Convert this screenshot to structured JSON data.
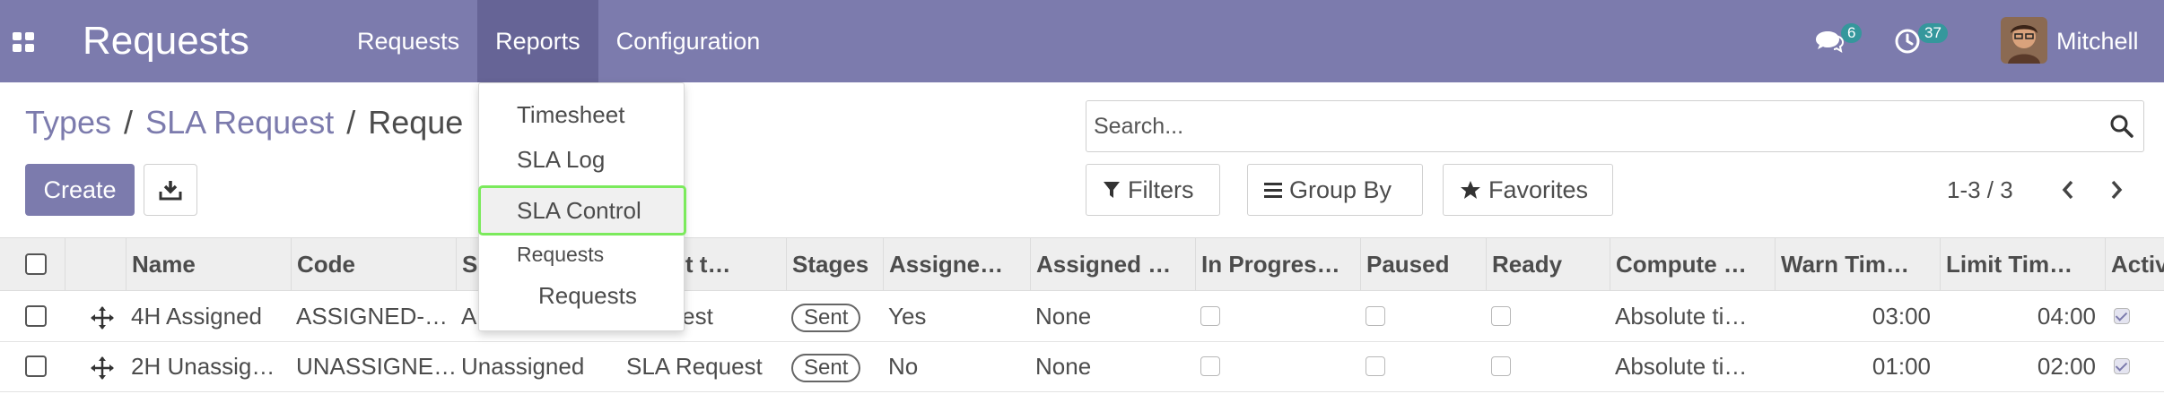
{
  "app": {
    "title": "Requests"
  },
  "menu": {
    "items": [
      "Requests",
      "Reports",
      "Configuration"
    ]
  },
  "systray": {
    "messages_count": "6",
    "activities_count": "37",
    "user_name": "Mitchell"
  },
  "reports_dropdown": {
    "items": [
      "Timesheet",
      "SLA Log",
      "SLA Control"
    ],
    "section_header": "Requests",
    "sub_items": [
      "Requests"
    ],
    "focused": "SLA Control"
  },
  "breadcrumb": {
    "items": [
      "Types",
      "SLA Request",
      "Reque"
    ]
  },
  "buttons": {
    "create": "Create"
  },
  "search": {
    "placeholder": "Search...",
    "value": ""
  },
  "filters": {
    "filters": "Filters",
    "group_by": "Group By",
    "favorites": "Favorites"
  },
  "pager": {
    "value": "1-3 / 3"
  },
  "table": {
    "columns": [
      "Name",
      "Code",
      "S",
      "est t…",
      "Stages",
      "Assigne…",
      "Assigned …",
      "In Progres…",
      "Paused",
      "Ready",
      "Compute …",
      "Warn Tim…",
      "Limit Tim…",
      "Activ"
    ],
    "rows": [
      {
        "name": "4H Assigned",
        "code": "ASSIGNED-…",
        "s": "A",
        "request_type": "Request",
        "stage": "Sent",
        "assigned": "Yes",
        "assigned_to": "None",
        "in_progress": false,
        "paused": false,
        "ready": false,
        "compute": "Absolute ti…",
        "warn_time": "03:00",
        "limit_time": "04:00",
        "active": true
      },
      {
        "name": "2H Unassig…",
        "code": "UNASSIGNE…",
        "s": "Unassigned",
        "request_type": "SLA Request",
        "stage": "Sent",
        "assigned": "No",
        "assigned_to": "None",
        "in_progress": false,
        "paused": false,
        "ready": false,
        "compute": "Absolute ti…",
        "warn_time": "01:00",
        "limit_time": "02:00",
        "active": true
      }
    ]
  },
  "colors": {
    "brand": "#7c7bad",
    "brand_active": "#666496",
    "badge": "#35979c",
    "focus_outline": "#7bea5c"
  },
  "icons": {
    "apps": "apps-grid-icon",
    "messages": "chat-bubble-icon",
    "activities": "clock-icon",
    "download": "download-icon",
    "search": "search-icon",
    "filter": "funnel-icon",
    "group_by": "bars-icon",
    "favorites": "star-icon",
    "prev": "chevron-left-icon",
    "next": "chevron-right-icon",
    "drag": "move-arrows-icon"
  }
}
